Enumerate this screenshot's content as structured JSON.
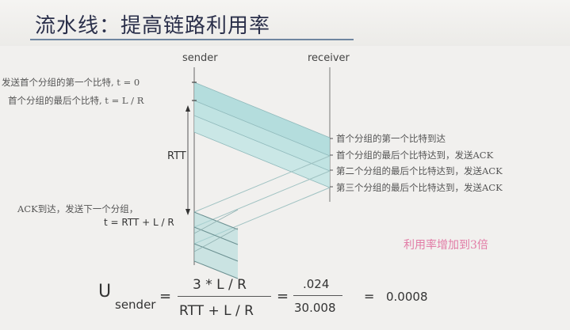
{
  "slide": {
    "title": "流水线：提高链路利用率",
    "sender_label": "sender",
    "receiver_label": "receiver",
    "sender_notes": {
      "first_bit_sent": "发送首个分组的第一个比特, t = 0",
      "last_bit_sent": "首个分组的最后个比特, t = L / R",
      "ack_arrives": "ACK到达，发送下一个分组，",
      "ack_time": "t = RTT + L / R"
    },
    "rtt_label": "RTT",
    "receiver_notes": [
      "首个分组的第一个比特到达",
      "首个分组的最后个比特达到，发送ACK",
      "第二个分组的最后个比特达到，发送ACK",
      "第三个分组的最后个比特达到，发送ACK"
    ],
    "highlight_note": "利用率增加到3倍",
    "formula": {
      "u": "U",
      "subscript": "sender",
      "numerator": "3 * L / R",
      "denominator": "RTT + L / R",
      "equals_1": "=",
      "value_numerator": ".024",
      "value_denominator": "30.008",
      "equals_2": "=",
      "result": "0.0008"
    }
  },
  "colors": {
    "packet_fill": "#a9d9d9",
    "line": "#555555",
    "title": "#2a2f4a",
    "highlight": "#e27ca6"
  }
}
